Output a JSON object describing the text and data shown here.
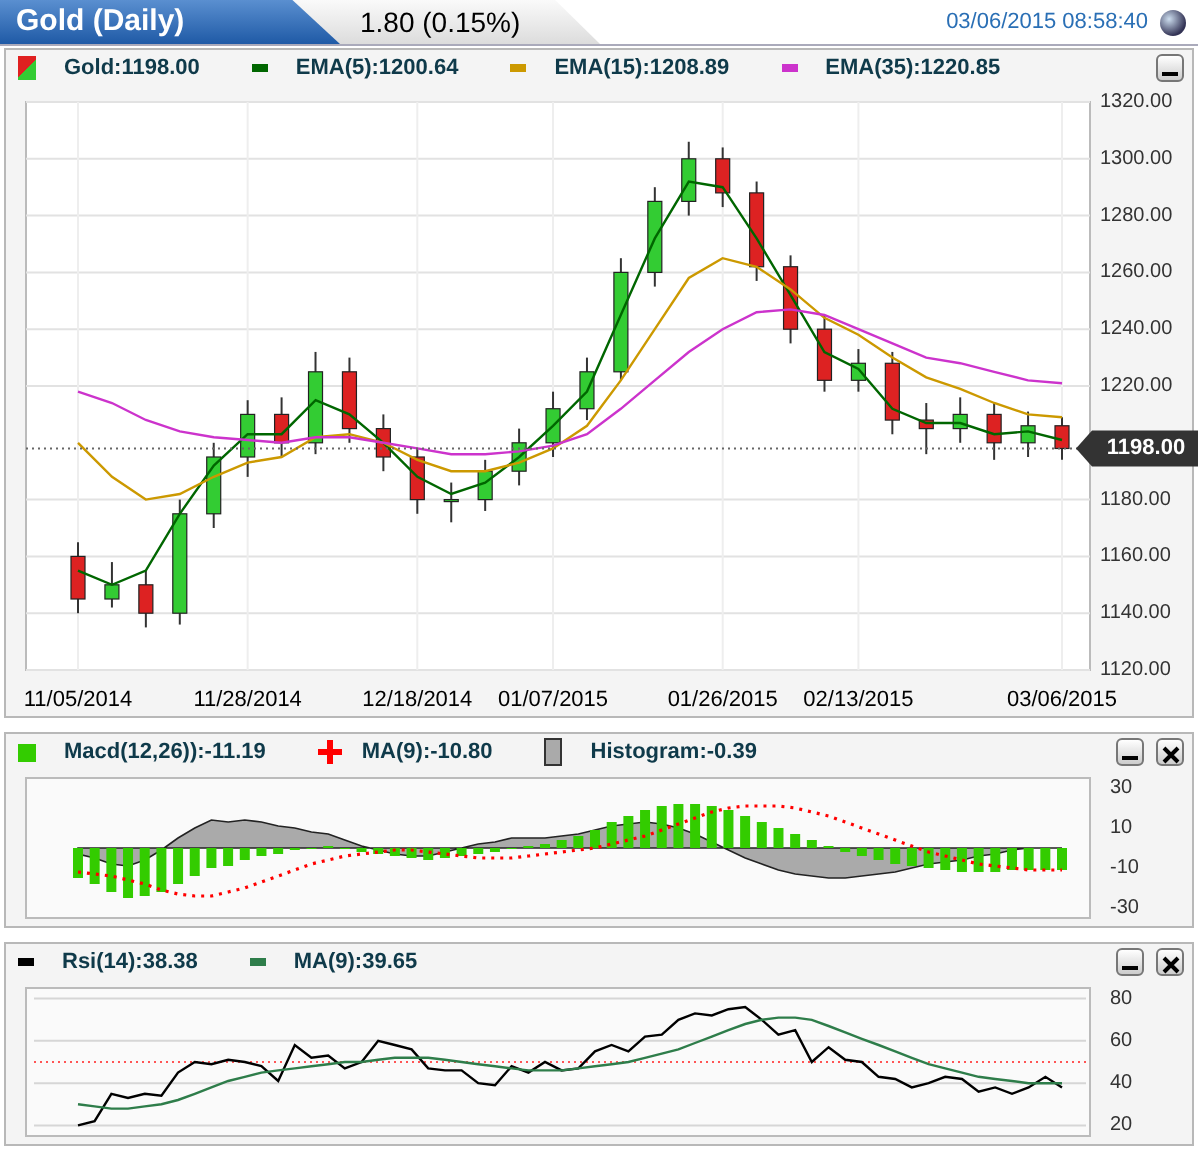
{
  "header": {
    "title": "Gold (Daily)",
    "change": "1.80 (0.15%)",
    "timestamp": "03/06/2015 08:58:40"
  },
  "main": {
    "legend": [
      {
        "kind": "candle",
        "label": "Gold:1198.00"
      },
      {
        "kind": "line",
        "label": "EMA(5):1200.64",
        "color": "#006600"
      },
      {
        "kind": "line",
        "label": "EMA(15):1208.89",
        "color": "#cc9900"
      },
      {
        "kind": "line",
        "label": "EMA(35):1220.85",
        "color": "#cc33cc"
      }
    ],
    "chart_data": {
      "type": "candlestick",
      "grid": true,
      "ylim": [
        1120,
        1320
      ],
      "ohlc": [
        [
          1160,
          1165,
          1140,
          1145
        ],
        [
          1145,
          1158,
          1142,
          1150
        ],
        [
          1150,
          1155,
          1135,
          1140
        ],
        [
          1140,
          1180,
          1136,
          1175
        ],
        [
          1175,
          1200,
          1170,
          1195
        ],
        [
          1195,
          1215,
          1188,
          1210
        ],
        [
          1210,
          1216,
          1195,
          1200
        ],
        [
          1200,
          1232,
          1196,
          1225
        ],
        [
          1225,
          1230,
          1200,
          1205
        ],
        [
          1205,
          1210,
          1190,
          1195
        ],
        [
          1195,
          1198,
          1175,
          1180
        ],
        [
          1180,
          1186,
          1172,
          1180
        ],
        [
          1180,
          1194,
          1176,
          1190
        ],
        [
          1190,
          1205,
          1185,
          1200
        ],
        [
          1200,
          1218,
          1195,
          1212
        ],
        [
          1212,
          1230,
          1208,
          1225
        ],
        [
          1225,
          1265,
          1222,
          1260
        ],
        [
          1260,
          1290,
          1255,
          1285
        ],
        [
          1285,
          1306,
          1280,
          1300
        ],
        [
          1300,
          1304,
          1283,
          1288
        ],
        [
          1288,
          1292,
          1257,
          1262
        ],
        [
          1262,
          1266,
          1235,
          1240
        ],
        [
          1240,
          1245,
          1218,
          1222
        ],
        [
          1222,
          1233,
          1218,
          1228
        ],
        [
          1228,
          1232,
          1203,
          1208
        ],
        [
          1208,
          1214,
          1196,
          1205
        ],
        [
          1205,
          1216,
          1200,
          1210
        ],
        [
          1210,
          1214,
          1194,
          1200
        ],
        [
          1200,
          1211,
          1195,
          1206
        ],
        [
          1206,
          1209,
          1194,
          1198
        ]
      ],
      "categories": [
        "11/05/2014",
        null,
        null,
        null,
        null,
        "11/28/2014",
        null,
        null,
        null,
        null,
        "12/18/2014",
        null,
        null,
        null,
        "01/07/2015",
        null,
        null,
        null,
        null,
        "01/26/2015",
        null,
        null,
        null,
        "02/13/2015",
        null,
        null,
        null,
        null,
        null,
        "03/06/2015"
      ],
      "yticks": [
        {
          "value": 1320,
          "label": "1320.00"
        },
        {
          "value": 1300,
          "label": "1300.00"
        },
        {
          "value": 1280,
          "label": "1280.00"
        },
        {
          "value": 1260,
          "label": "1260.00"
        },
        {
          "value": 1240,
          "label": "1240.00"
        },
        {
          "value": 1220,
          "label": "1220.00"
        },
        {
          "value": 1180,
          "label": "1180.00"
        },
        {
          "value": 1160,
          "label": "1160.00"
        },
        {
          "value": 1140,
          "label": "1140.00"
        },
        {
          "value": 1120,
          "label": "1120.00"
        }
      ],
      "ref_lines": [
        {
          "axis": "y",
          "value": 1198,
          "label": "1198.00"
        }
      ],
      "series": [
        {
          "color": "#006600",
          "type": "line",
          "values": [
            1155,
            1150,
            1155,
            1175,
            1192,
            1203,
            1203,
            1215,
            1210,
            1200,
            1188,
            1182,
            1186,
            1195,
            1206,
            1218,
            1245,
            1272,
            1292,
            1290,
            1272,
            1252,
            1232,
            1226,
            1212,
            1207,
            1207,
            1203,
            1204,
            1201
          ]
        },
        {
          "color": "#cc9900",
          "type": "line",
          "values": [
            1200,
            1188,
            1180,
            1182,
            1188,
            1193,
            1195,
            1202,
            1203,
            1200,
            1194,
            1190,
            1190,
            1193,
            1198,
            1206,
            1222,
            1240,
            1258,
            1265,
            1262,
            1254,
            1244,
            1238,
            1230,
            1223,
            1219,
            1214,
            1210,
            1209
          ]
        },
        {
          "color": "#cc33cc",
          "type": "line",
          "values": [
            1218,
            1214,
            1208,
            1204,
            1202,
            1201,
            1200,
            1202,
            1202,
            1200,
            1198,
            1196,
            1196,
            1197,
            1199,
            1203,
            1212,
            1222,
            1232,
            1240,
            1246,
            1247,
            1245,
            1240,
            1235,
            1230,
            1228,
            1225,
            1222,
            1221
          ]
        }
      ]
    }
  },
  "macd": {
    "legend": [
      {
        "kind": "square",
        "label": "Macd(12,26)):-11.19",
        "color": "#33cc00"
      },
      {
        "kind": "cross",
        "label": "MA(9):-10.80",
        "color": "#ff0000"
      },
      {
        "kind": "hist",
        "label": "Histogram:-0.39",
        "color": "#aaaaaa"
      }
    ],
    "chart_data": {
      "type": "bar",
      "ylim": [
        -35,
        35
      ],
      "yticks": [
        30,
        10,
        -10,
        -30
      ],
      "series": [
        {
          "color": "#33cc00",
          "values": [
            -15,
            -18,
            -22,
            -25,
            -24,
            -22,
            -18,
            -14,
            -10,
            -9,
            -6,
            -4,
            -3,
            -1,
            0,
            1,
            0,
            -2,
            -3,
            -4,
            -5,
            -6,
            -5,
            -4,
            -3,
            -2,
            0,
            1,
            2,
            4,
            6,
            9,
            13,
            16,
            19,
            21,
            22,
            22,
            21,
            19,
            16,
            13,
            10,
            7,
            4,
            1,
            -2,
            -4,
            -6,
            -8,
            -9,
            -10,
            -11,
            -12,
            -12,
            -12,
            -11,
            -11,
            -11,
            -11
          ]
        },
        {
          "color": "#ff0000",
          "type": "line",
          "line_style": "dotted",
          "values": [
            -12,
            -13,
            -14,
            -16,
            -18,
            -21,
            -23,
            -24,
            -24,
            -22,
            -20,
            -17,
            -14,
            -11,
            -8,
            -6,
            -4,
            -3,
            -2,
            -1,
            -1,
            -2,
            -3,
            -4,
            -5,
            -5,
            -5,
            -4,
            -3,
            -2,
            -1,
            0,
            2,
            4,
            6,
            9,
            12,
            15,
            18,
            20,
            21,
            21,
            21,
            20,
            18,
            16,
            13,
            10,
            7,
            4,
            1,
            -2,
            -4,
            -6,
            -8,
            -9,
            -10,
            -11,
            -11,
            -11
          ]
        }
      ]
    }
  },
  "rsi": {
    "legend": [
      {
        "kind": "line",
        "label": "Rsi(14):38.38",
        "color": "#000000"
      },
      {
        "kind": "line",
        "label": "MA(9):39.65",
        "color": "#2e7d4a"
      }
    ],
    "chart_data": {
      "type": "line",
      "grid": true,
      "ylim": [
        15,
        85
      ],
      "yticks": [
        80,
        60,
        40,
        20
      ],
      "ref_lines": [
        {
          "axis": "y",
          "value": 50
        }
      ],
      "series": [
        {
          "color": "#000000",
          "values": [
            20,
            22,
            35,
            33,
            35,
            34,
            45,
            50,
            49,
            51,
            50,
            48,
            41,
            58,
            52,
            53,
            47,
            50,
            60,
            58,
            56,
            47,
            46,
            46,
            40,
            39,
            48,
            45,
            50,
            46,
            47,
            55,
            58,
            55,
            62,
            63,
            70,
            73,
            72,
            75,
            76,
            70,
            63,
            65,
            50,
            57,
            51,
            50,
            43,
            42,
            38,
            40,
            43,
            42,
            36,
            38,
            35,
            38,
            43,
            38
          ]
        },
        {
          "color": "#2e7d4a",
          "values": [
            30,
            29,
            28,
            28,
            29,
            30,
            32,
            35,
            38,
            41,
            43,
            45,
            46,
            47,
            48,
            49,
            50,
            50,
            51,
            52,
            52,
            52,
            51,
            50,
            49,
            48,
            47,
            46,
            46,
            46,
            47,
            48,
            49,
            50,
            52,
            54,
            56,
            59,
            62,
            65,
            68,
            70,
            71,
            71,
            70,
            67,
            64,
            61,
            58,
            55,
            52,
            49,
            47,
            45,
            43,
            42,
            41,
            40,
            40,
            40
          ]
        }
      ]
    }
  }
}
